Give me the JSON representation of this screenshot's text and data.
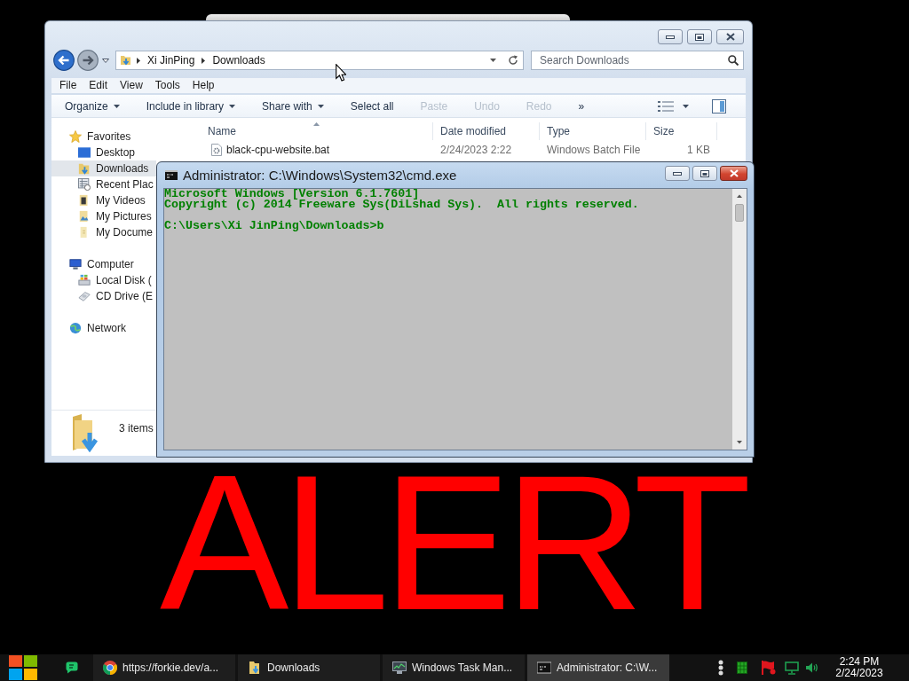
{
  "explorer": {
    "address": {
      "path": [
        "Xi JinPing",
        "Downloads"
      ]
    },
    "search": {
      "placeholder": "Search Downloads"
    },
    "menu": [
      "File",
      "Edit",
      "View",
      "Tools",
      "Help"
    ],
    "toolbar": [
      {
        "label": "Organize",
        "dropdown": true,
        "disabled": false
      },
      {
        "label": "Include in library",
        "dropdown": true,
        "disabled": false
      },
      {
        "label": "Share with",
        "dropdown": true,
        "disabled": false
      },
      {
        "label": "Select all",
        "dropdown": false,
        "disabled": false
      },
      {
        "label": "Paste",
        "dropdown": false,
        "disabled": true
      },
      {
        "label": "Undo",
        "dropdown": false,
        "disabled": true
      },
      {
        "label": "Redo",
        "dropdown": false,
        "disabled": true
      },
      {
        "label": "»",
        "dropdown": false,
        "disabled": false
      }
    ],
    "nav": [
      {
        "label": "Favorites",
        "kind": "star",
        "selected": false,
        "children": [
          {
            "label": "Desktop",
            "kind": "desktop",
            "selected": false
          },
          {
            "label": "Downloads",
            "kind": "downloads",
            "selected": true
          },
          {
            "label": "Recent Plac",
            "kind": "recent",
            "selected": false
          },
          {
            "label": "My Videos",
            "kind": "videos",
            "selected": false
          },
          {
            "label": "My Pictures",
            "kind": "pictures",
            "selected": false
          },
          {
            "label": "My Docume",
            "kind": "documents",
            "selected": false
          }
        ]
      },
      {
        "label": "Computer",
        "kind": "computer",
        "selected": false,
        "children": [
          {
            "label": "Local Disk (",
            "kind": "disk",
            "selected": false
          },
          {
            "label": "CD Drive (E",
            "kind": "cd",
            "selected": false
          }
        ]
      },
      {
        "label": "Network",
        "kind": "network",
        "selected": false
      }
    ],
    "columns": [
      {
        "label": "Name",
        "sorted": true
      },
      {
        "label": "Date modified",
        "sorted": false
      },
      {
        "label": "Type",
        "sorted": false
      },
      {
        "label": "Size",
        "sorted": false
      }
    ],
    "files": [
      {
        "name": "black-cpu-website.bat",
        "date_modified": "2/24/2023 2:22",
        "type": "Windows Batch File",
        "size": "1 KB"
      }
    ],
    "status": "3 items"
  },
  "console": {
    "title": "Administrator: C:\\Windows\\System32\\cmd.exe",
    "output": [
      "Microsoft Windows [Version 6.1.7601]",
      "Copyright (c) 2014 Freeware Sys(DiLshad Sys).  All rights reserved."
    ],
    "prompt": "C:\\Users\\Xi JinPing\\Downloads>b"
  },
  "alert": "ALERT",
  "taskbar": {
    "tasks": [
      {
        "label": "https://forkie.dev/a...",
        "kind": "browser",
        "selected": false
      },
      {
        "label": "Downloads",
        "kind": "folder",
        "selected": false
      },
      {
        "label": "Windows Task Man...",
        "kind": "task_manager",
        "selected": false
      },
      {
        "label": "Administrator: C:\\W...",
        "kind": "console",
        "selected": true
      }
    ],
    "clock": {
      "time": "2:24 PM",
      "date": "2/24/2023"
    }
  }
}
